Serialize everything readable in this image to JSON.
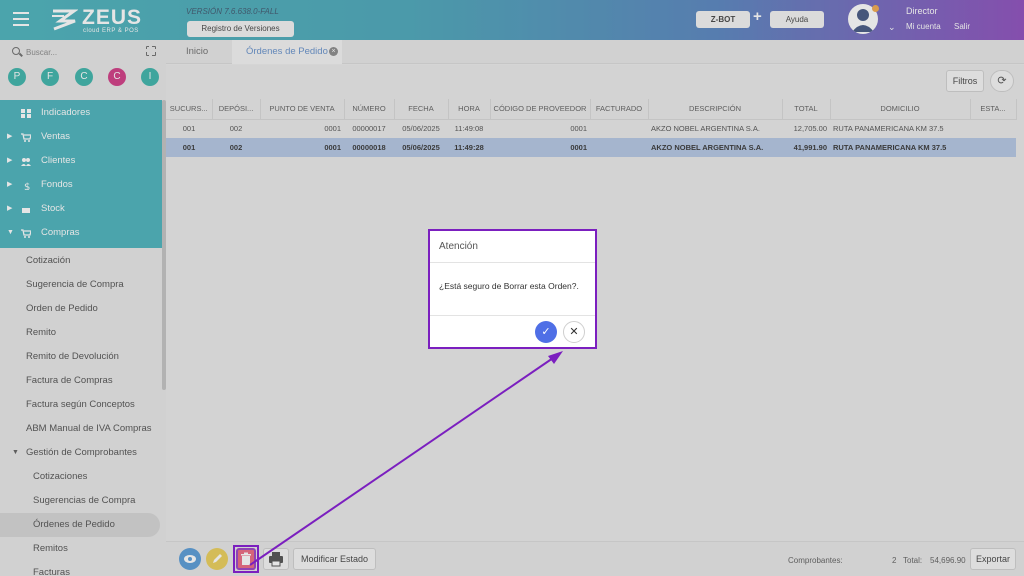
{
  "header": {
    "logo": "ZEUS",
    "logo_sub": "cloud ERP & POS",
    "version": "VERSIÓN 7.6.638.0-FALL",
    "versions_button": "Registro de Versiones",
    "zbot_button": "Z-BOT",
    "plus": "+",
    "help_button": "Ayuda",
    "user_name": "Director",
    "account_link": "Mi cuenta",
    "exit_link": "Salir"
  },
  "sidebar": {
    "search_placeholder": "Buscar...",
    "circles": [
      {
        "letter": "P",
        "color": "#1aa79b"
      },
      {
        "letter": "F",
        "color": "#1aa79b"
      },
      {
        "letter": "C",
        "color": "#1aa79b"
      },
      {
        "letter": "C",
        "color": "#c9186f"
      },
      {
        "letter": "I",
        "color": "#1aa79b"
      }
    ],
    "menu": [
      {
        "label": "Indicadores",
        "icon": "chart-icon"
      },
      {
        "label": "Ventas",
        "icon": "cart-icon"
      },
      {
        "label": "Clientes",
        "icon": "people-icon"
      },
      {
        "label": "Fondos",
        "icon": "dollar-icon"
      },
      {
        "label": "Stock",
        "icon": "box-icon"
      },
      {
        "label": "Compras",
        "icon": "cart-plus-icon"
      }
    ],
    "submenu": [
      "Cotización",
      "Sugerencia de Compra",
      "Orden de Pedido",
      "Remito",
      "Remito de Devolución",
      "Factura de Compras",
      "Factura según Conceptos",
      "ABM Manual de IVA Compras",
      "Gestión de Comprobantes",
      "Cotizaciones",
      "Sugerencias de Compra",
      "Órdenes de Pedido",
      "Remitos",
      "Facturas"
    ]
  },
  "tabs": {
    "home": "Inicio",
    "orders": "Órdenes de Pedido",
    "close": "×"
  },
  "toolbar": {
    "filters": "Filtros",
    "refresh": "⟳"
  },
  "table": {
    "columns": [
      "SUCURS...",
      "DEPÓSI...",
      "PUNTO DE VENTA",
      "NÚMERO",
      "FECHA",
      "HORA",
      "CÓDIGO DE PROVEEDOR",
      "FACTURADO",
      "DESCRIPCIÓN",
      "TOTAL",
      "DOMICILIO",
      "ESTA..."
    ],
    "rows": [
      [
        "001",
        "002",
        "0001",
        "00000017",
        "05/06/2025",
        "11:49:08",
        "0001",
        "",
        "AKZO NOBEL ARGENTINA S.A.",
        "12,705.00",
        "RUTA PANAMERICANA KM 37.5",
        ""
      ],
      [
        "001",
        "002",
        "0001",
        "00000018",
        "05/06/2025",
        "11:49:28",
        "0001",
        "",
        "AKZO NOBEL ARGENTINA S.A.",
        "41,991.90",
        "RUTA PANAMERICANA KM 37.5",
        ""
      ]
    ]
  },
  "footer": {
    "status_button": "Modificar Estado",
    "comprobantes_label": "Comprobantes:",
    "count": "2",
    "total_label": "Total:",
    "total_value": "54,696.90",
    "export_button": "Exportar"
  },
  "dialog": {
    "title": "Atención",
    "message": "¿Está seguro de Borrar esta Orden?.",
    "ok": "✓",
    "cancel": "✕"
  },
  "colors": {
    "teal": "#2aa6b0",
    "purple": "#7b1fbf",
    "selected_row": "#a7bde0",
    "delete": "#e94e6b"
  }
}
